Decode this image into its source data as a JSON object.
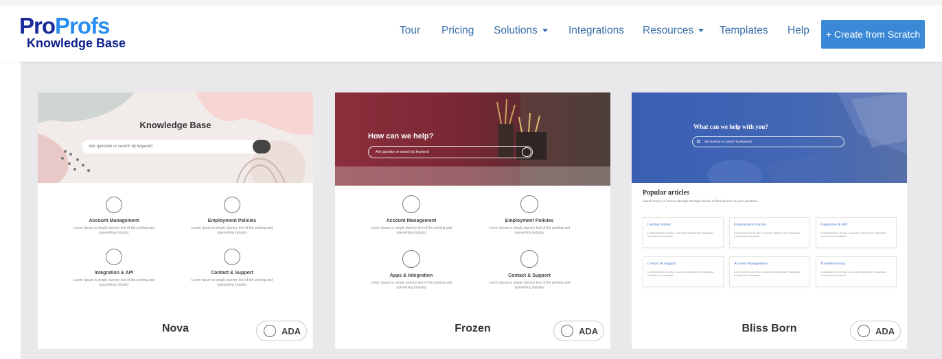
{
  "header": {
    "logo": {
      "part1": "Pro",
      "part2": "Profs",
      "subtitle": "Knowledge Base"
    },
    "nav": [
      {
        "label": "Tour",
        "dropdown": false
      },
      {
        "label": "Pricing",
        "dropdown": false
      },
      {
        "label": "Solutions",
        "dropdown": true
      },
      {
        "label": "Integrations",
        "dropdown": false
      },
      {
        "label": "Resources",
        "dropdown": true
      },
      {
        "label": "Templates",
        "dropdown": false
      },
      {
        "label": "Help",
        "dropdown": false
      }
    ],
    "create_button": "+ Create from Scratch"
  },
  "colors": {
    "accent": "#3a88d6",
    "nav_text": "#3a6fa8",
    "logo_dark": "#1a2a9c",
    "logo_light": "#2a8df0"
  },
  "templates": [
    {
      "name": "Nova",
      "ada_label": "ADA",
      "hero_title": "Knowledge Base",
      "search_placeholder": "Ask question or search by keyword",
      "features": [
        {
          "icon": "user-icon",
          "title": "Account Management",
          "desc": "Lorem Ipsum is simply dummy text of the printing and typesetting industry"
        },
        {
          "icon": "shield-check-icon",
          "title": "Employment Policies",
          "desc": "Lorem Ipsum is simply dummy text of the printing and typesetting industry"
        },
        {
          "icon": "tools-icon",
          "title": "Integration & API",
          "desc": "Lorem Ipsum is simply dummy text of the printing and typesetting industry"
        },
        {
          "icon": "support-chat-icon",
          "title": "Contact & Support",
          "desc": "Lorem Ipsum is simply dummy text of the printing and typesetting industry"
        }
      ]
    },
    {
      "name": "Frozen",
      "ada_label": "ADA",
      "hero_title": "How can we help?",
      "search_placeholder": "Ask question or search by keyword",
      "features": [
        {
          "icon": "user-icon",
          "title": "Account Management",
          "desc": "Lorem Ipsum is simply dummy text of the printing and typesetting industry"
        },
        {
          "icon": "shield-check-icon",
          "title": "Employment Policies",
          "desc": "Lorem Ipsum is simply dummy text of the printing and typesetting industry"
        },
        {
          "icon": "tools-icon",
          "title": "Apps & Integration",
          "desc": "Lorem Ipsum is simply dummy text of the printing and typesetting industry"
        },
        {
          "icon": "support-chat-icon",
          "title": "Contact & Support",
          "desc": "Lorem Ipsum is simply dummy text of the printing and typesetting industry"
        }
      ]
    },
    {
      "name": "Bliss Born",
      "ada_label": "ADA",
      "hero_title": "What can we help with you?",
      "search_placeholder": "Ask question or search by keyword",
      "popular_title": "Popular articles",
      "popular_sub": "Search above, or browse through the topics below to find answers to your questions",
      "topics": [
        {
          "title": "Getting Started",
          "desc": "Lorem ipsum dolor sit amet, consectetur adipiscing elit. Suspendisse consequat auctor maximus."
        },
        {
          "title": "Employment Policies",
          "desc": "Lorem ipsum dolor sit amet, consectetur adipiscing elit. Suspendisse consequat auctor maximus."
        },
        {
          "title": "Integration & API",
          "desc": "Lorem ipsum dolor sit amet, consectetur adipiscing elit. Suspendisse consequat auctor maximus."
        },
        {
          "title": "Contact & Support",
          "desc": "Lorem ipsum dolor sit amet, consectetur adipiscing elit. Suspendisse consequat auctor maximus."
        },
        {
          "title": "Account Management",
          "desc": "Lorem ipsum dolor sit amet, consectetur adipiscing elit. Suspendisse consequat auctor maximus."
        },
        {
          "title": "Troubleshooting",
          "desc": "Lorem ipsum dolor sit amet, consectetur adipiscing elit. Suspendisse consequat auctor maximus."
        }
      ]
    }
  ]
}
